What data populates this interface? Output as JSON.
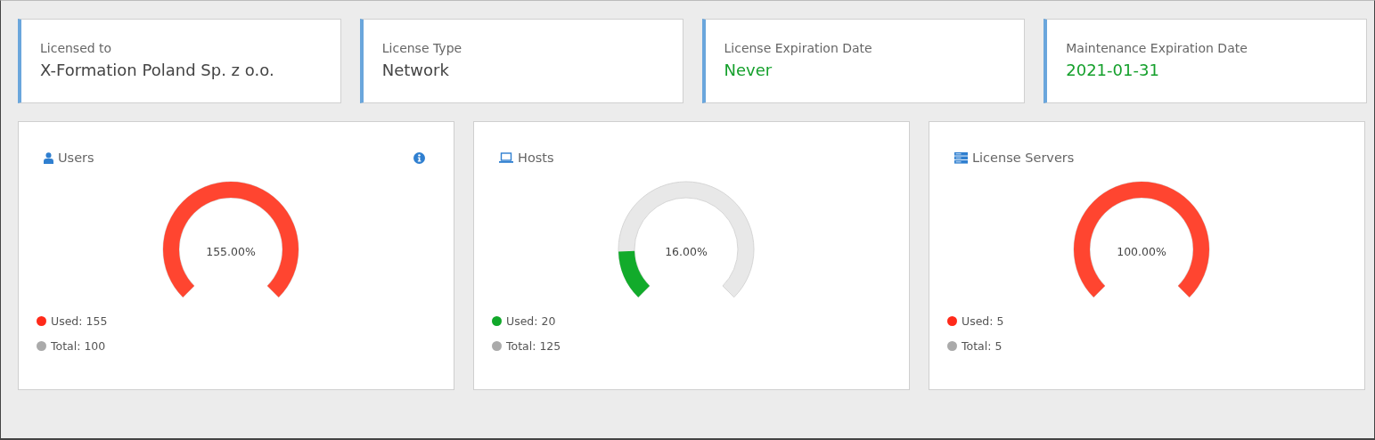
{
  "info_cards": [
    {
      "label": "Licensed to",
      "value": "X-Formation Poland Sp. z o.o.",
      "kind": "plain"
    },
    {
      "label": "License Type",
      "value": "Network",
      "kind": "plain"
    },
    {
      "label": "License Expiration Date",
      "value": "Never",
      "kind": "ok"
    },
    {
      "label": "Maintenance Expiration Date",
      "value": "2021-01-31",
      "kind": "ok"
    }
  ],
  "gauge_cards": [
    {
      "title": "Users",
      "kind": "users",
      "info": true,
      "percent": "155.00%",
      "level": 1,
      "color": "#ff4530",
      "legend": [
        {
          "label": "Used: 155",
          "color": "#ff2a1a"
        },
        {
          "label": "Total: 100",
          "color": "#aaaaaa"
        }
      ]
    },
    {
      "title": "Hosts",
      "kind": "hosts",
      "info": false,
      "percent": "16.00%",
      "level": 0.16,
      "color": "#12ab2b",
      "legend": [
        {
          "label": "Used: 20",
          "color": "#11a82a"
        },
        {
          "label": "Total: 125",
          "color": "#aaaaaa"
        }
      ]
    },
    {
      "title": "License Servers",
      "kind": "servers",
      "info": false,
      "percent": "100.00%",
      "level": 1,
      "color": "#ff4530",
      "legend": [
        {
          "label": "Used: 5",
          "color": "#ff2a1a"
        },
        {
          "label": "Total: 5",
          "color": "#aaaaaa"
        }
      ]
    }
  ]
}
